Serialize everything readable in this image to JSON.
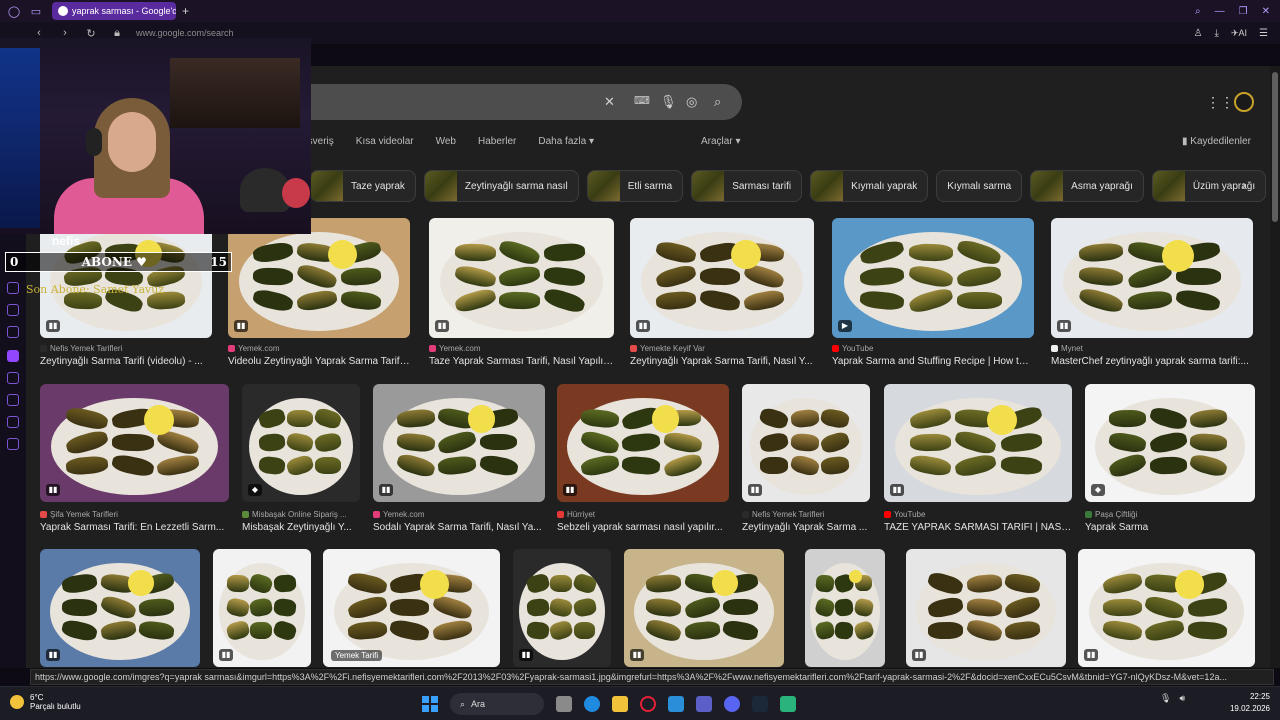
{
  "browser": {
    "tab_title": "yaprak sarması - Google'da",
    "url": "www.google.com/search",
    "ai_label": "AI"
  },
  "search": {
    "filters": [
      "Alışveriş",
      "Kısa videolar",
      "Web",
      "Haberler",
      "Daha fazla"
    ],
    "tools_label": "Araçlar",
    "saved_label": "Kaydedilenler"
  },
  "chips": [
    {
      "label": "Taze yaprak",
      "has_thumb": true
    },
    {
      "label": "Zeytinyağlı sarma nasıl",
      "has_thumb": true
    },
    {
      "label": "Etli sarma",
      "has_thumb": true
    },
    {
      "label": "Sarması tarifi",
      "has_thumb": true
    },
    {
      "label": "Kıymalı yaprak",
      "has_thumb": true
    },
    {
      "label": "Kıymalı sarma",
      "has_thumb": false
    },
    {
      "label": "Asma yaprağı",
      "has_thumb": true
    },
    {
      "label": "Üzüm yaprağı",
      "has_thumb": true
    }
  ],
  "row1": [
    {
      "source": "Nefis Yemek Tarifleri",
      "caption": "Zeytinyağlı Sarma Tarifi (videolu) - ...",
      "fav": "#2a2a2a"
    },
    {
      "source": "Yemek.com",
      "caption": "Videolu Zeytinyağlı Yaprak Sarma Tarifi -...",
      "fav": "#e23c7b"
    },
    {
      "source": "Yemek.com",
      "caption": "Taze Yaprak Sarması Tarifi, Nasıl Yapılır...",
      "fav": "#e23c7b"
    },
    {
      "source": "Yemekte Keyif Var",
      "caption": "Zeytinyağlı Yaprak Sarma Tarifi, Nasıl Y...",
      "fav": "#e34a4a"
    },
    {
      "source": "YouTube",
      "caption": "Yaprak Sarma and Stuffing Recipe | How to ...",
      "fav": "#ff0000"
    },
    {
      "source": "Mynet",
      "caption": "MasterChef zeytinyağlı yaprak sarma tarifi:...",
      "fav": "#f0f0f0"
    }
  ],
  "row2": [
    {
      "source": "Şifa Yemek Tarifleri",
      "caption": "Yaprak Sarması Tarifi: En Lezzetli Sarm...",
      "fav": "#e34a4a"
    },
    {
      "source": "Misbaşak Online Sipariş ...",
      "caption": "Misbaşak Zeytinyağlı Y...",
      "fav": "#5a8a3a"
    },
    {
      "source": "Yemek.com",
      "caption": "Sodalı Yaprak Sarma Tarifi, Nasıl Ya...",
      "fav": "#e23c7b"
    },
    {
      "source": "Hürriyet",
      "caption": "Sebzeli yaprak sarması nasıl yapılır...",
      "fav": "#e53935"
    },
    {
      "source": "Nefis Yemek Tarifleri",
      "caption": "Zeytinyağlı Yaprak Sarma ...",
      "fav": "#2a2a2a"
    },
    {
      "source": "YouTube",
      "caption": "TAZE YAPRAK SARMASI TARİFİ | NASI...",
      "fav": "#ff0000"
    },
    {
      "source": "Paşa Çiftliği",
      "caption": "Yaprak Sarma",
      "fav": "#3a7a3a"
    }
  ],
  "row3_label": "Yemek Tarifi",
  "image_watermark": "nefis",
  "status_link": "https://www.google.com/imgres?q=yaprak sarması&imgurl=https%3A%2F%2Fi.nefisyemektarifleri.com%2F2013%2F03%2Fyaprak-sarmasi1.jpg&imgrefurl=https%3A%2F%2Fwww.nefisyemektarifleri.com%2Ftarif-yaprak-sarmasi-2%2F&docid=xenCxxECu5CsvM&tbnid=YG7-nlQyKDsz-M&vet=12a...",
  "overlay": {
    "sub_left": "0",
    "sub_label": "ABONE ♥",
    "sub_right": "15",
    "last_sub": "Son Abone: Samet Yavuz"
  },
  "taskbar": {
    "temp": "6°C",
    "weather": "Parçalı bulutlu",
    "search_label": "Ara",
    "time": "22:25",
    "date": "19.02.2026"
  },
  "colors": {
    "accent": "#5a2b9e",
    "page_bg": "#1f1f1f",
    "subscriber_gold": "#c9b23a"
  }
}
